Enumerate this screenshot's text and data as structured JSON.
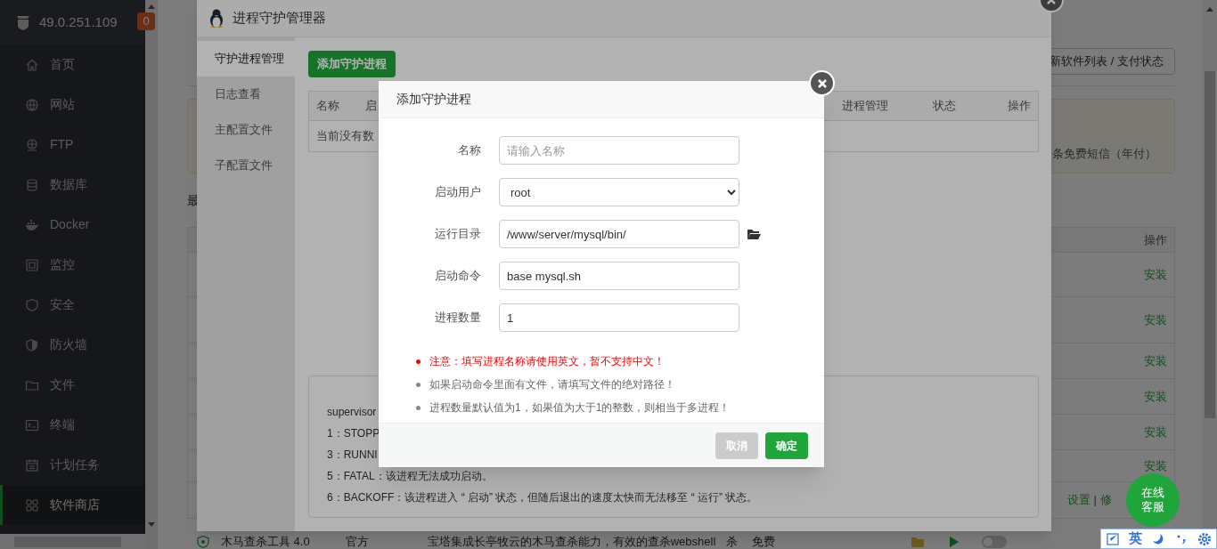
{
  "sidebar": {
    "host": "49.0.251.109",
    "badge": "0",
    "items": [
      {
        "label": "首页",
        "selected": false
      },
      {
        "label": "网站",
        "selected": false
      },
      {
        "label": "FTP",
        "selected": false
      },
      {
        "label": "数据库",
        "selected": false
      },
      {
        "label": "Docker",
        "selected": false
      },
      {
        "label": "监控",
        "selected": false
      },
      {
        "label": "安全",
        "selected": false
      },
      {
        "label": "防火墙",
        "selected": false
      },
      {
        "label": "文件",
        "selected": false
      },
      {
        "label": "终端",
        "selected": false
      },
      {
        "label": "计划任务",
        "selected": false
      },
      {
        "label": "软件商店",
        "selected": true
      }
    ]
  },
  "page": {
    "update_button": "新软件列表 / 支付状态",
    "notice_fragment": "条免费短信（年付）",
    "section_fragment": "最",
    "table_header": "操作",
    "rows": [
      {
        "action": "安装"
      },
      {
        "action": "安装"
      },
      {
        "action": "安装"
      },
      {
        "action": "安装"
      },
      {
        "action": "安装"
      },
      {
        "action": "安装"
      }
    ],
    "last_row": {
      "settings": "设置",
      "separator": "|",
      "fragment": "修"
    },
    "bottom_row": {
      "name": "木马查杀工具 4.0",
      "developer": "官方",
      "description": "宝塔集成长亭牧云的木马查杀能力，有效的查杀webshell",
      "fragment": "杀",
      "price": "免费",
      "on": false
    }
  },
  "window": {
    "title": "进程守护管理器",
    "tabs": [
      {
        "label": "守护进程管理",
        "selected": true
      },
      {
        "label": "日志查看",
        "selected": false
      },
      {
        "label": "主配置文件",
        "selected": false
      },
      {
        "label": "子配置文件",
        "selected": false
      }
    ],
    "add_button": "添加守护进程",
    "columns": [
      "名称",
      "启",
      "进程管理",
      "状态",
      "操作"
    ],
    "empty_text": "当前没有数",
    "info_lines": [
      "supervisor",
      "1：STOPP",
      "3：RUNNI",
      "5：FATAL：该进程无法成功启动。",
      "6：BACKOFF：该进程进入 “ 启动” 状态，但随后退出的速度太快而无法移至 “ 运行” 状态。"
    ]
  },
  "dialog": {
    "title": "添加守护进程",
    "fields": [
      {
        "label": "名称",
        "kind": "text",
        "placeholder": "请输入名称"
      },
      {
        "label": "启动用户",
        "kind": "select",
        "value": "root"
      },
      {
        "label": "运行目录",
        "kind": "path",
        "value": "/www/server/mysql/bin/"
      },
      {
        "label": "启动命令",
        "kind": "text",
        "value": "base mysql.sh"
      },
      {
        "label": "进程数量",
        "kind": "text",
        "value": "1"
      }
    ],
    "notes": [
      {
        "text": "注意：填写进程名称请使用英文，暂不支持中文！",
        "kind": "warning"
      },
      {
        "text": "如果启动命令里面有文件，请填写文件的绝对路径！",
        "kind": "info"
      },
      {
        "text": "进程数量默认值为1，如果值为大于1的整数，则相当于多进程！",
        "kind": "info"
      }
    ],
    "cancel": "取消",
    "confirm": "确定"
  },
  "chat_button": "在线客服",
  "ime": {
    "mode": "英"
  }
}
